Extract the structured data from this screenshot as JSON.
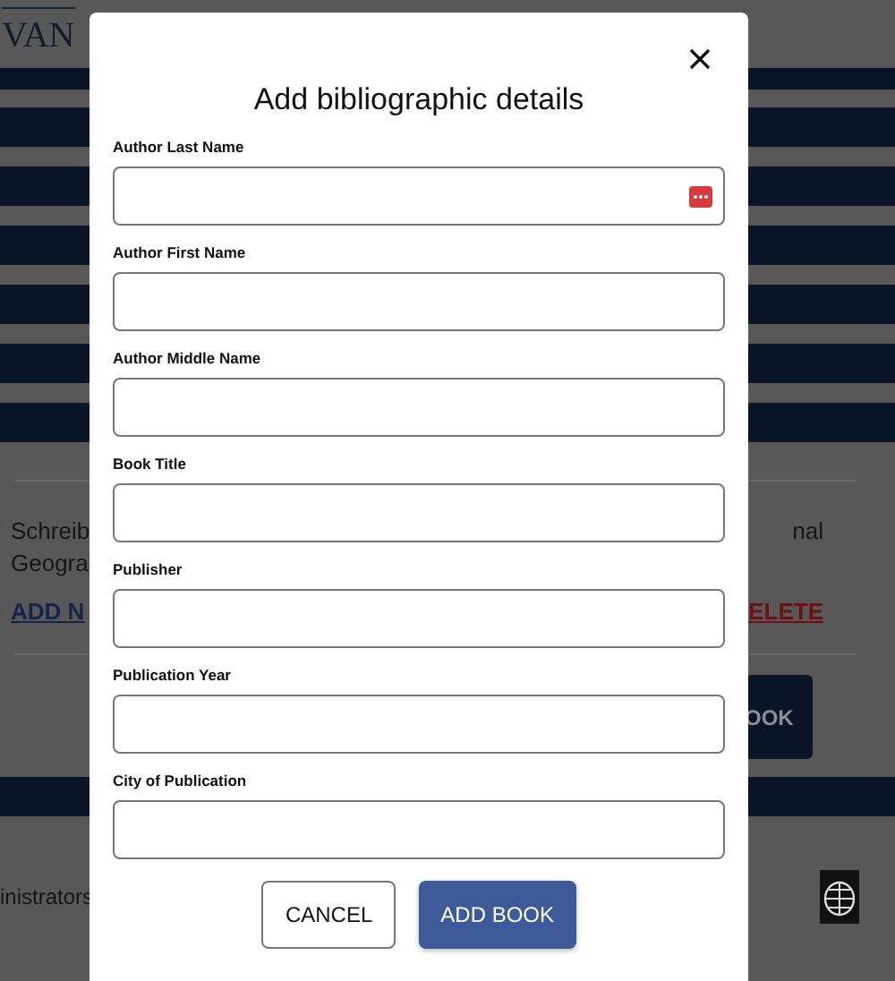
{
  "background": {
    "brand": "VAN",
    "entry_left": [
      "Schreib",
      "Geogra"
    ],
    "entry_right": "nal",
    "add_link": "ADD N",
    "delete_link": "ELETE",
    "book_button": "OOK",
    "footer_text": "inistrators"
  },
  "modal": {
    "title": "Add bibliographic details",
    "fields": [
      {
        "label": "Author Last Name",
        "kind": "autofill"
      },
      {
        "label": "Author First Name",
        "kind": "plain"
      },
      {
        "label": "Author Middle Name",
        "kind": "plain"
      },
      {
        "label": "Book Title",
        "kind": "plain"
      },
      {
        "label": "Publisher",
        "kind": "plain"
      },
      {
        "label": "Publication Year",
        "kind": "plain"
      },
      {
        "label": "City of Publication",
        "kind": "plain"
      }
    ],
    "buttons": [
      {
        "label": "CANCEL",
        "kind": "secondary"
      },
      {
        "label": "ADD BOOK",
        "kind": "primary"
      }
    ]
  }
}
